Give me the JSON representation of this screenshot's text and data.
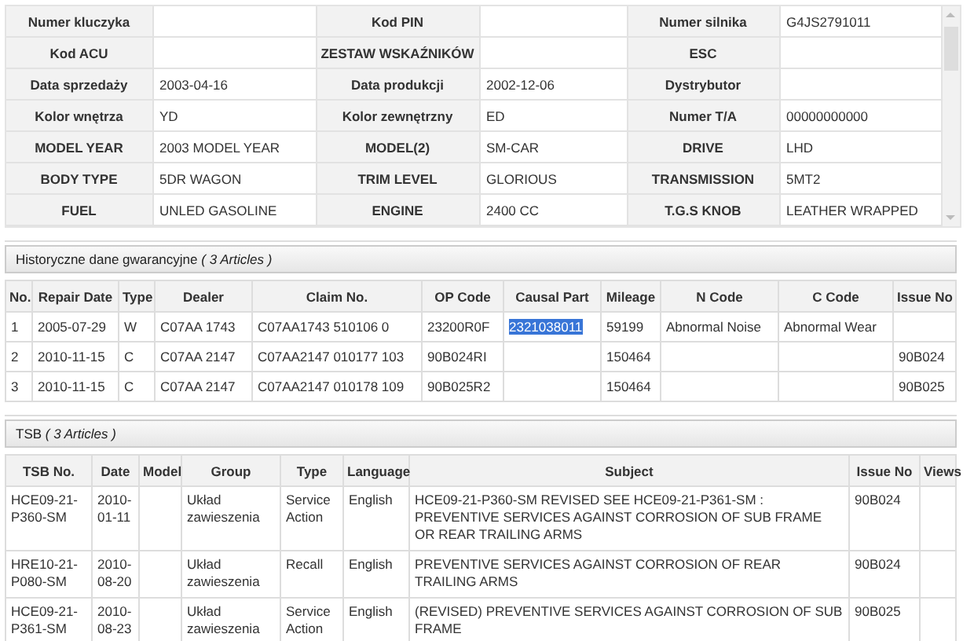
{
  "vehicle_info": {
    "rows": [
      [
        {
          "label": "Numer kluczyka"
        },
        {
          "label": "Kod PIN"
        },
        {
          "label": "Numer silnika",
          "value": "G4JS2791011"
        }
      ],
      [
        {
          "label": "Kod ACU"
        },
        {
          "label": "ZESTAW WSKAŹNIKÓW"
        },
        {
          "label": "ESC"
        }
      ],
      [
        {
          "label": "Data sprzedaży",
          "value": "2003-04-16"
        },
        {
          "label": "Data produkcji",
          "value": "2002-12-06"
        },
        {
          "label": "Dystrybutor"
        }
      ],
      [
        {
          "label": "Kolor wnętrza",
          "value": "YD"
        },
        {
          "label": "Kolor zewnętrzny",
          "value": "ED"
        },
        {
          "label": "Numer T/A",
          "value": "00000000000"
        }
      ],
      [
        {
          "label": "MODEL YEAR",
          "value": "2003 MODEL YEAR"
        },
        {
          "label": "MODEL(2)",
          "value": "SM-CAR"
        },
        {
          "label": "DRIVE",
          "value": "LHD"
        }
      ],
      [
        {
          "label": "BODY TYPE",
          "value": "5DR WAGON"
        },
        {
          "label": "TRIM LEVEL",
          "value": "GLORIOUS"
        },
        {
          "label": "TRANSMISSION",
          "value": "5MT2"
        }
      ],
      [
        {
          "label": "FUEL",
          "value": "UNLED GASOLINE"
        },
        {
          "label": "ENGINE",
          "value": "2400 CC"
        },
        {
          "label": "T.G.S KNOB",
          "value": "LEATHER WRAPPED"
        }
      ]
    ]
  },
  "warranty": {
    "title": "Historyczne dane gwarancyjne",
    "count": "( 3 Articles )",
    "columns": [
      "No.",
      "Repair Date",
      "Type",
      "Dealer",
      "Claim No.",
      "OP Code",
      "Causal Part",
      "Mileage",
      "N Code",
      "C Code",
      "Issue No"
    ],
    "rows": [
      {
        "cells": [
          "1",
          "2005-07-29",
          "W",
          "C07AA 1743",
          "C07AA1743 510106 0",
          "23200R0F",
          "2321038011",
          "59199",
          "Abnormal Noise",
          "Abnormal Wear",
          ""
        ],
        "causal_part_selected": true
      },
      {
        "cells": [
          "2",
          "2010-11-15",
          "C",
          "C07AA 2147",
          "C07AA2147 010177 103",
          "90B024RI",
          "",
          "150464",
          "",
          "",
          "90B024"
        ]
      },
      {
        "cells": [
          "3",
          "2010-11-15",
          "C",
          "C07AA 2147",
          "C07AA2147 010178 109",
          "90B025R2",
          "",
          "150464",
          "",
          "",
          "90B025"
        ]
      }
    ]
  },
  "tsb": {
    "title": "TSB",
    "count": "( 3 Articles )",
    "columns": [
      "TSB No.",
      "Date",
      "Model",
      "Group",
      "Type",
      "Language",
      "Subject",
      "Issue No",
      "Views"
    ],
    "rows": [
      {
        "cells": [
          "HCE09-21-P360-SM",
          "2010-01-11",
          "",
          "Układ zawieszenia",
          "Service Action",
          "English",
          "HCE09-21-P360-SM REVISED SEE HCE09-21-P361-SM : PREVENTIVE SERVICES AGAINST CORROSION OF SUB FRAME OR REAR TRAILING ARMS",
          "90B024",
          ""
        ]
      },
      {
        "cells": [
          "HRE10-21-P080-SM",
          "2010-08-20",
          "",
          "Układ zawieszenia",
          "Recall",
          "English",
          "PREVENTIVE SERVICES AGAINST CORROSION OF REAR TRAILING ARMS",
          "90B024",
          ""
        ]
      },
      {
        "cells": [
          "HCE09-21-P361-SM",
          "2010-08-23",
          "",
          "Układ zawieszenia",
          "Service Action",
          "English",
          "(REVISED) PREVENTIVE SERVICES AGAINST CORROSION OF SUB FRAME",
          "90B025",
          ""
        ]
      }
    ]
  }
}
